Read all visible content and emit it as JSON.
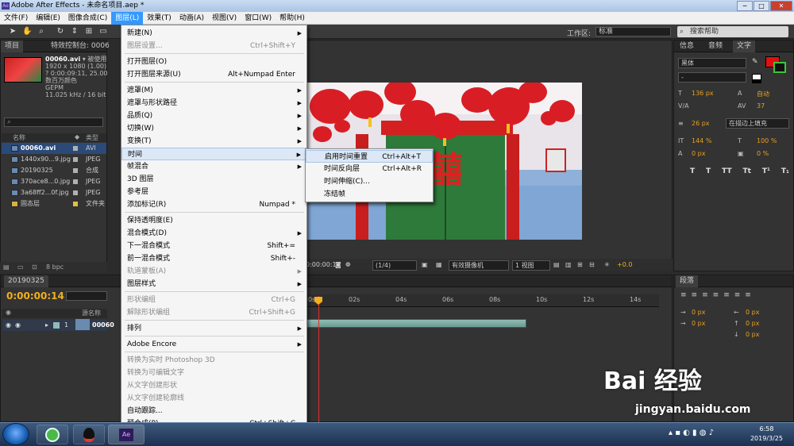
{
  "window": {
    "title": "Adobe After Effects - 未命名项目.aep *",
    "min": "─",
    "max": "□",
    "close": "✕"
  },
  "menubar": [
    "文件(F)",
    "编辑(E)",
    "图像合成(C)",
    "图层(L)",
    "效果(T)",
    "动画(A)",
    "视图(V)",
    "窗口(W)",
    "帮助(H)"
  ],
  "toolbar": {
    "workspace_label": "工作区:",
    "workspace_value": "标准",
    "search_placeholder": "搜索帮助"
  },
  "project": {
    "tab": "项目",
    "tab2": "特效控制台: 00060.avi",
    "file_name": "00060.avi",
    "used": "▾ 被使用",
    "info": [
      "1920 x 1080 (1.00)",
      "? 0:00:09:11, 25.00 fr",
      "数百万颜色",
      "GEPM",
      "11.025 kHz / 16 bit U"
    ],
    "columns": {
      "name": "名称",
      "type": "类型"
    },
    "items": [
      {
        "name": "00060.avi",
        "type": "AVI",
        "color": "#b0b0b0",
        "selected": true
      },
      {
        "name": "1440x90...9.jpg",
        "type": "JPEG",
        "color": "#b0b0b0",
        "selected": false
      },
      {
        "name": "20190325",
        "type": "合成",
        "color": "#b0b0b0",
        "selected": false
      },
      {
        "name": "370ace8...0.jpg",
        "type": "JPEG",
        "color": "#b0b0b0",
        "selected": false
      },
      {
        "name": "3a68ff2...0f.jpg",
        "type": "JPEG",
        "color": "#b0b0b0",
        "selected": false
      },
      {
        "name": "固态层",
        "type": "文件夹",
        "color": "#e0c040",
        "selected": false
      }
    ],
    "bpc": "8 bpc"
  },
  "layer_menu": [
    {
      "label": "新建(N)",
      "shortcut": "",
      "submenu": true,
      "disabled": false
    },
    {
      "label": "图层设置...",
      "shortcut": "Ctrl+Shift+Y",
      "submenu": false,
      "disabled": true
    },
    {
      "sep": true
    },
    {
      "label": "打开图层(O)",
      "shortcut": "",
      "submenu": false,
      "disabled": false
    },
    {
      "label": "打开图层来源(U)",
      "shortcut": "Alt+Numpad Enter",
      "submenu": false,
      "disabled": false
    },
    {
      "sep": true
    },
    {
      "label": "遮罩(M)",
      "shortcut": "",
      "submenu": true,
      "disabled": false
    },
    {
      "label": "遮罩与形状路径",
      "shortcut": "",
      "submenu": true,
      "disabled": false
    },
    {
      "label": "品质(Q)",
      "shortcut": "",
      "submenu": true,
      "disabled": false
    },
    {
      "label": "切换(W)",
      "shortcut": "",
      "submenu": true,
      "disabled": false
    },
    {
      "label": "变换(T)",
      "shortcut": "",
      "submenu": true,
      "disabled": false
    },
    {
      "label": "时间",
      "shortcut": "",
      "submenu": true,
      "disabled": false,
      "highlight": true
    },
    {
      "label": "帧混合",
      "shortcut": "",
      "submenu": true,
      "disabled": false
    },
    {
      "label": "3D 图层",
      "shortcut": "",
      "submenu": false,
      "disabled": false
    },
    {
      "label": "参考层",
      "shortcut": "",
      "submenu": false,
      "disabled": false
    },
    {
      "label": "添加标记(R)",
      "shortcut": "Numpad *",
      "submenu": false,
      "disabled": false
    },
    {
      "sep": true
    },
    {
      "label": "保持透明度(E)",
      "shortcut": "",
      "submenu": false,
      "disabled": false
    },
    {
      "label": "混合模式(D)",
      "shortcut": "",
      "submenu": true,
      "disabled": false
    },
    {
      "label": "下一混合模式",
      "shortcut": "Shift+=",
      "submenu": false,
      "disabled": false
    },
    {
      "label": "前一混合模式",
      "shortcut": "Shift+-",
      "submenu": false,
      "disabled": false
    },
    {
      "label": "轨道蒙板(A)",
      "shortcut": "",
      "submenu": true,
      "disabled": true
    },
    {
      "label": "图层样式",
      "shortcut": "",
      "submenu": true,
      "disabled": false
    },
    {
      "sep": true
    },
    {
      "label": "形状编组",
      "shortcut": "Ctrl+G",
      "submenu": false,
      "disabled": true
    },
    {
      "label": "解除形状编组",
      "shortcut": "Ctrl+Shift+G",
      "submenu": false,
      "disabled": true
    },
    {
      "sep": true
    },
    {
      "label": "排列",
      "shortcut": "",
      "submenu": true,
      "disabled": false
    },
    {
      "sep": true
    },
    {
      "label": "Adobe Encore",
      "shortcut": "",
      "submenu": true,
      "disabled": false
    },
    {
      "sep": true
    },
    {
      "label": "转换为实时 Photoshop 3D",
      "shortcut": "",
      "submenu": false,
      "disabled": true
    },
    {
      "label": "转换为可编辑文字",
      "shortcut": "",
      "submenu": false,
      "disabled": true
    },
    {
      "label": "从文字创建形状",
      "shortcut": "",
      "submenu": false,
      "disabled": true
    },
    {
      "label": "从文字创建轮廓线",
      "shortcut": "",
      "submenu": false,
      "disabled": true
    },
    {
      "label": "自动跟踪...",
      "shortcut": "",
      "submenu": false,
      "disabled": false
    },
    {
      "label": "预合成(P)...",
      "shortcut": "Ctrl+Shift+C",
      "submenu": false,
      "disabled": false
    }
  ],
  "time_submenu": [
    {
      "label": "启用时间重置",
      "shortcut": "Ctrl+Alt+T",
      "highlight": true
    },
    {
      "label": "时间反向层",
      "shortcut": "Ctrl+Alt+R",
      "highlight": false
    },
    {
      "label": "时间伸缩(C)...",
      "shortcut": "",
      "highlight": false
    },
    {
      "label": "冻结帧",
      "shortcut": "",
      "highlight": false
    }
  ],
  "comp_viewer": {
    "timecode": "0:00:00:14",
    "resolution": "(1/4)",
    "camera": "有效摄像机",
    "views": "1 视图",
    "exposure": "+0.0"
  },
  "right_panel": {
    "tabs": [
      "信息",
      "音频",
      "文字"
    ],
    "font": "黑体",
    "style": "-",
    "size": "136 px",
    "leading": "自动",
    "tracking_label": "V/A",
    "tracking": "37",
    "stroke_size": "26 px",
    "stroke_mode": "在描边上填充",
    "v_scale": "144 %",
    "h_scale": "100 %",
    "baseline": "0 px",
    "tsume": "0 %",
    "styles": [
      "T",
      "T",
      "TT",
      "Tt",
      "T¹",
      "T₁"
    ]
  },
  "paragraph": {
    "tab": "段落",
    "values": [
      "0 px",
      "0 px",
      "0 px",
      "0 px",
      "0 px"
    ]
  },
  "timeline": {
    "tab": "20190325",
    "time": "0:00:00:14",
    "ticks": [
      "0s",
      "02s",
      "04s",
      "06s",
      "08s",
      "10s",
      "12s",
      "14s"
    ],
    "col_source": "源名称",
    "layer_num": "1",
    "layer_name": "00060"
  },
  "taskbar": {
    "time": "6:58",
    "date": "2019/3/25",
    "ch": "CH"
  },
  "watermark": {
    "text": "Bai 经验",
    "sub": "jingyan.baidu.com"
  }
}
